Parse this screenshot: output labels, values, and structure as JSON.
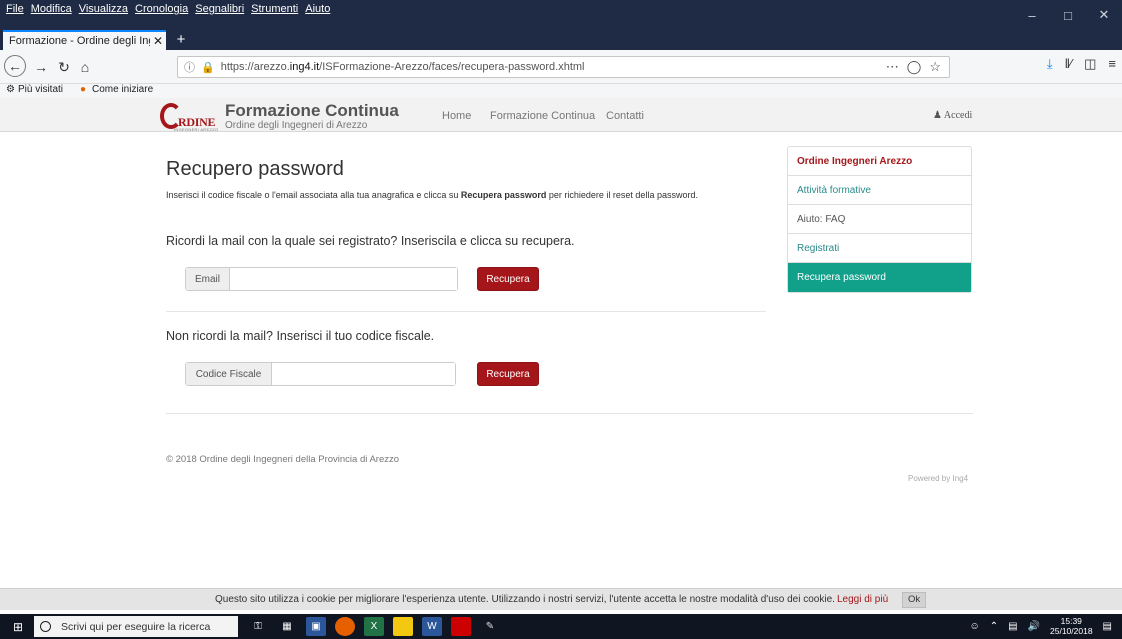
{
  "browser": {
    "menu": [
      "File",
      "Modifica",
      "Visualizza",
      "Cronologia",
      "Segnalibri",
      "Strumenti",
      "Aiuto"
    ],
    "tab_title": "Formazione - Ordine degli Ingegne",
    "url_prefix": "https://arezzo.",
    "url_host": "ing4.it",
    "url_path": "/ISFormazione-Arezzo/faces/recupera-password.xhtml",
    "bookmarks": [
      "Più visitati",
      "Come iniziare"
    ]
  },
  "site": {
    "logo_letters": "RDINE",
    "logo_caption": "INGEGNERI AREZZO",
    "brand_title": "Formazione Continua",
    "brand_subtitle": "Ordine degli Ingegneri di Arezzo",
    "nav": [
      "Home",
      "Formazione Continua",
      "Contatti"
    ],
    "login_label": "Accedi"
  },
  "main": {
    "title": "Recupero password",
    "intro_before": "Inserisci il codice fiscale o l'email associata alla tua anagrafica e clicca su ",
    "intro_bold": "Recupera password",
    "intro_after": " per richiedere il reset della password.",
    "email_section": {
      "question": "Ricordi la mail con la quale sei registrato? Inseriscila e clicca su recupera.",
      "field_label": "Email",
      "value": "",
      "button": "Recupera"
    },
    "cf_section": {
      "question": "Non ricordi la mail? Inserisci il tuo codice fiscale.",
      "field_label": "Codice Fiscale",
      "value": "",
      "button": "Recupera"
    }
  },
  "sidebar": {
    "items": [
      {
        "label": "Ordine Ingegneri Arezzo"
      },
      {
        "label": "Attività formative"
      },
      {
        "label": "Aiuto: FAQ"
      },
      {
        "label": "Registrati"
      },
      {
        "label": "Recupera password"
      }
    ]
  },
  "footer": {
    "copyright": "© 2018 Ordine degli Ingegneri della Provincia di Arezzo",
    "powered": "Powered by Ing4"
  },
  "cookie": {
    "message": "Questo sito utilizza i cookie per migliorare l'esperienza utente. Utilizzando i nostri servizi, l'utente accetta le nostre modalità d'uso dei cookie.",
    "more_link": "Leggi di più",
    "ok_button": "Ok"
  },
  "taskbar": {
    "search_placeholder": "Scrivi qui per eseguire la ricerca",
    "time": "15:39",
    "date": "25/10/2018"
  },
  "colors": {
    "brand_red": "#a4161a",
    "active_teal": "#11a08a",
    "link_teal": "#2a8a8a"
  }
}
